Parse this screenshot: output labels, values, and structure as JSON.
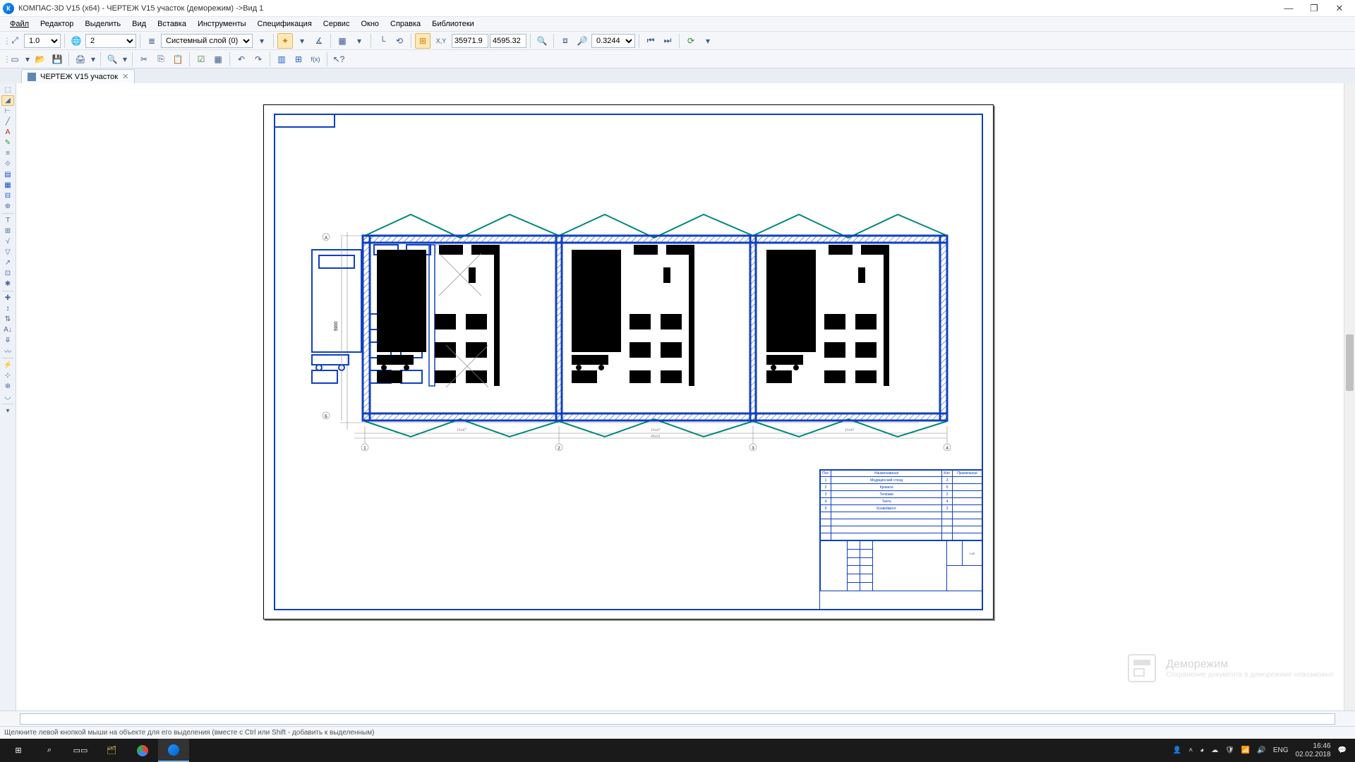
{
  "titlebar": {
    "app_title": "КОМПАС-3D V15 (x64) - ЧЕРТЕЖ V15 участок (деморежим) ->Вид 1"
  },
  "menu": [
    "Файл",
    "Редактор",
    "Выделить",
    "Вид",
    "Вставка",
    "Инструменты",
    "Спецификация",
    "Сервис",
    "Окно",
    "Справка",
    "Библиотеки"
  ],
  "toolbar1": {
    "step": "1.0",
    "state_num": "2",
    "layer": "Системный слой (0)",
    "coord_x": "35971.9",
    "coord_y": "4595.32",
    "zoom": "0.3244"
  },
  "doctab": {
    "label": "ЧЕРТЕЖ V15 участок"
  },
  "titleblock": {
    "header": [
      "Поз.",
      "Наименование",
      "Кол.",
      "Примечание"
    ],
    "rows": [
      [
        "1",
        "Медицинский стенд",
        "3",
        ""
      ],
      [
        "2",
        "Кровати",
        "5",
        ""
      ],
      [
        "3",
        "Тележки",
        "2",
        ""
      ],
      [
        "4",
        "Тахта",
        "4",
        ""
      ],
      [
        "5",
        "Конвеймент",
        "3",
        ""
      ]
    ]
  },
  "watermark": {
    "title": "Деморежим",
    "sub": "Сохранение документа в деморежиме невозможно"
  },
  "status": "Щелкните левой кнопкой мыши на объекте для его выделения (вместе с Ctrl или Shift - добавить к выделенным)",
  "taskbar": {
    "lang": "ENG",
    "time": "16:46",
    "date": "02.02.2018"
  }
}
